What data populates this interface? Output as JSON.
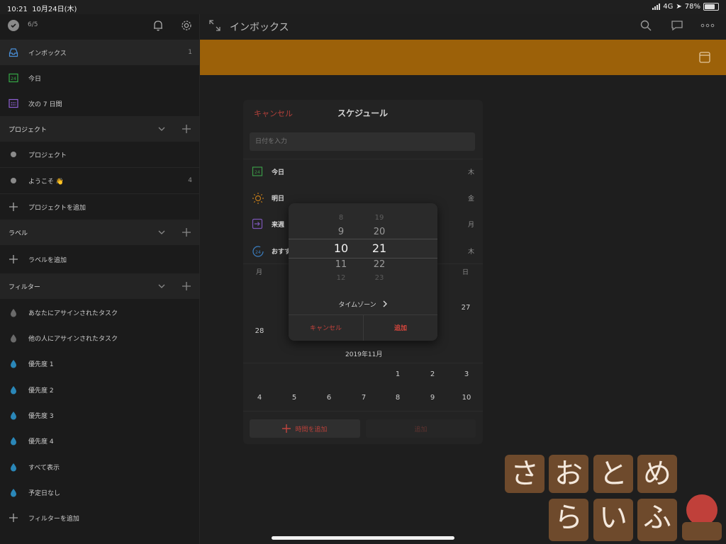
{
  "status": {
    "time": "10:21",
    "date": "10月24日(木)",
    "network": "4G",
    "battery": "78%"
  },
  "sidebar": {
    "karma": "6/5",
    "top_items": [
      {
        "label": "インボックス",
        "count": "1",
        "color": "#4a90d9"
      },
      {
        "label": "今日",
        "color": "#35a846"
      },
      {
        "label": "次の 7 日間",
        "color": "#8e5fd3"
      }
    ],
    "projects_header": "プロジェクト",
    "projects": [
      {
        "label": "プロジェクト",
        "count": ""
      },
      {
        "label": "ようこそ 👋",
        "count": "4"
      }
    ],
    "add_project": "プロジェクトを追加",
    "labels_header": "ラベル",
    "add_label": "ラベルを追加",
    "filters_header": "フィルター",
    "filters": [
      {
        "label": "あなたにアサインされたタスク",
        "color": "#6a6a6a"
      },
      {
        "label": "他の人にアサインされたタスク",
        "color": "#6a6a6a"
      },
      {
        "label": "優先度 1",
        "color": "#2a87b8"
      },
      {
        "label": "優先度 2",
        "color": "#2a87b8"
      },
      {
        "label": "優先度 3",
        "color": "#2a87b8"
      },
      {
        "label": "優先度 4",
        "color": "#2a87b8"
      },
      {
        "label": "すべて表示",
        "color": "#2a87b8"
      },
      {
        "label": "予定日なし",
        "color": "#2a87b8"
      }
    ],
    "add_filter": "フィルターを追加"
  },
  "header": {
    "title": "インボックス"
  },
  "colors": {
    "accent_red": "#d8453c",
    "banner": "#9c6109"
  },
  "schedule": {
    "cancel": "キャンセル",
    "title": "スケジュール",
    "input_placeholder": "日付を入力",
    "options": [
      {
        "label": "今日",
        "day": "木",
        "icon": "calendar-24-icon"
      },
      {
        "label": "明日",
        "day": "金",
        "icon": "sun-icon"
      },
      {
        "label": "来週",
        "day": "月",
        "icon": "arrow-box-icon"
      },
      {
        "label": "おすす",
        "day": "木",
        "icon": "clock-24-icon"
      }
    ],
    "weekday_start": "月",
    "weekday_end": "日",
    "partial_days": [
      "28",
      "27"
    ],
    "month_label": "2019年11月",
    "week1": [
      "1",
      "2",
      "3"
    ],
    "week2": [
      "4",
      "5",
      "6",
      "7",
      "8",
      "9",
      "10"
    ],
    "add_time": "時間を追加",
    "done": "追加"
  },
  "time_picker": {
    "hours": [
      "8",
      "9",
      "10",
      "11",
      "12"
    ],
    "minutes": [
      "19",
      "20",
      "21",
      "22",
      "23"
    ],
    "timezone": "タイムゾーン",
    "cancel": "キャンセル",
    "add": "追加"
  },
  "watermark": {
    "line1": [
      "さ",
      "お",
      "と",
      "め"
    ],
    "line2": [
      "ら",
      "い",
      "ふ"
    ]
  }
}
